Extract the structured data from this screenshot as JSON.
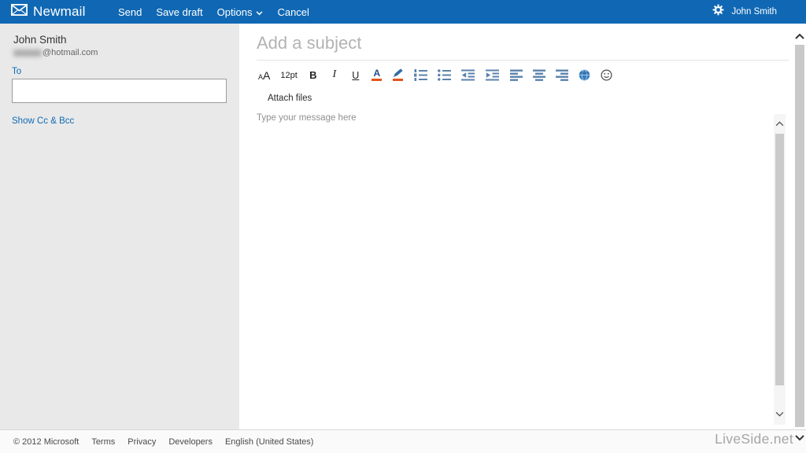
{
  "colors": {
    "topbar_blue": "#1068b4",
    "link_blue": "#0f6ab4",
    "toolbar_icon_blue": "#5b82ab",
    "accent_orange": "#e0551f",
    "sidebar_gray": "#e9e9e9"
  },
  "topbar": {
    "app_name": "Newmail",
    "nav": [
      {
        "label": "Send"
      },
      {
        "label": "Save draft"
      },
      {
        "label": "Options"
      },
      {
        "label": "Cancel"
      }
    ],
    "user_name": "John Smith"
  },
  "sidebar": {
    "sender_name": "John Smith",
    "sender_email_domain": "@hotmail.com",
    "to_label": "To",
    "to_value": "",
    "show_cc_bcc_label": "Show Cc & Bcc"
  },
  "compose": {
    "subject_placeholder": "Add a subject",
    "attach_files_label": "Attach files",
    "body_placeholder": "Type your message here",
    "toolbar": {
      "font_small_a": "A",
      "font_large_a": "A",
      "font_size_label": "12pt",
      "bold_label": "B",
      "italic_label": "I",
      "underline_label": "U",
      "font_color_label": "A"
    }
  },
  "footer": {
    "copyright": "© 2012 Microsoft",
    "links": [
      {
        "label": "Terms"
      },
      {
        "label": "Privacy"
      },
      {
        "label": "Developers"
      },
      {
        "label": "English (United States)"
      }
    ]
  },
  "watermark": "LiveSide.net"
}
